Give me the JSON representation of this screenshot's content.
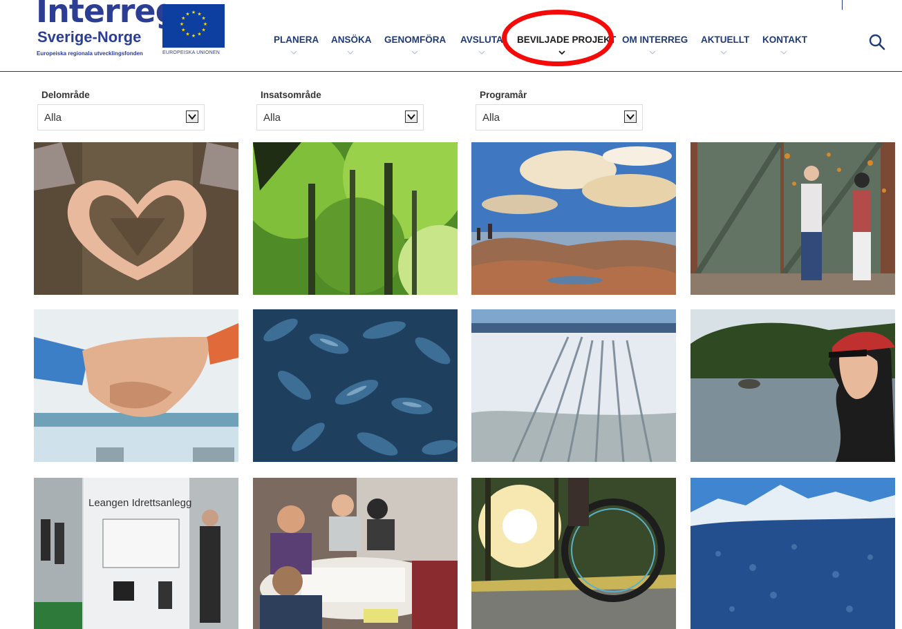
{
  "brand": {
    "logo_word": "Interreg",
    "logo_sub": "Sverige-Norge",
    "logo_tag": "Europeiska regionala utvecklingsfonden",
    "eu_caption": "EUROPEISKA UNIONEN"
  },
  "nav": {
    "items": [
      {
        "label": "PLANERA"
      },
      {
        "label": "ANSÖKA"
      },
      {
        "label": "GENOMFÖRA"
      },
      {
        "label": "AVSLUTA"
      },
      {
        "label": "BEVILJADE PROJEKT"
      },
      {
        "label": "OM INTERREG"
      },
      {
        "label": "AKTUELLT"
      },
      {
        "label": "KONTAKT"
      }
    ],
    "active": "BEVILJADE PROJEKT",
    "search_icon": "search-icon"
  },
  "filters": [
    {
      "label": "Delområde",
      "value": "Alla"
    },
    {
      "label": "Insatsområde",
      "value": "Alla"
    },
    {
      "label": "Programår",
      "value": "Alla"
    }
  ],
  "tiles": {
    "sign_text": "Leangen Idrettsanlegg"
  },
  "colors": {
    "brand": "#2b3e93",
    "nav_text": "#1e3a78",
    "highlight": "#f50a0a"
  }
}
